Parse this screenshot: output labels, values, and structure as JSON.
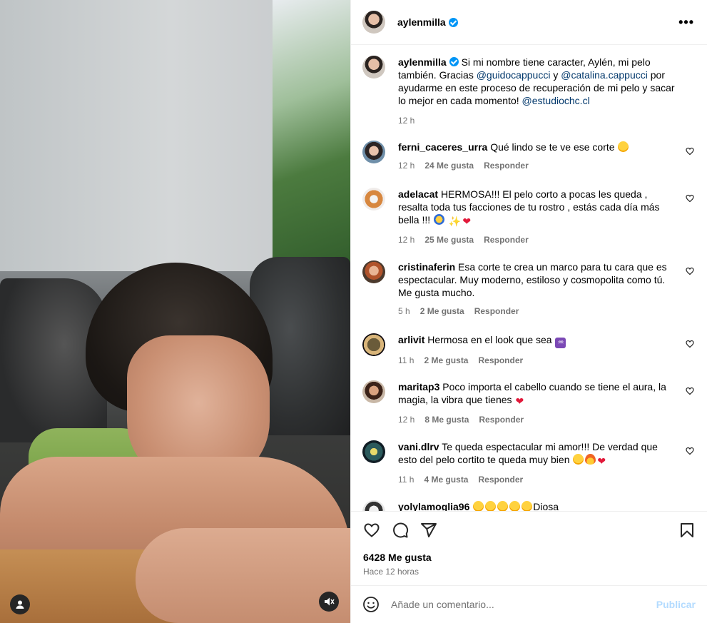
{
  "post": {
    "username": "aylenmilla",
    "caption_before": " Si mi nombre tiene caracter, Aylén, mi pelo también. Gracias ",
    "mention1": "@guidocappucci",
    "caption_mid": " y ",
    "mention2": "@catalina.cappucci",
    "caption_after": " por ayudarme en este proceso de recuperación de mi pelo y sacar lo mejor en cada momento! ",
    "mention3": "@estudiochc.cl",
    "caption_time": "12 h"
  },
  "comments": [
    {
      "username": "ferni_caceres_urra",
      "text": "Qué lindo se te ve ese corte",
      "emojis": [
        "star-eyes"
      ],
      "time": "12 h",
      "likes": "24 Me gusta",
      "reply": "Responder"
    },
    {
      "username": "adelacat",
      "text": "HERMOSA!!! El pelo corto a pocas les queda , resalta toda tus facciones de tu rostro , estás cada día más bella !!!",
      "emojis": [
        "sunglasses",
        "sparkles",
        "heart"
      ],
      "time": "12 h",
      "likes": "25 Me gusta",
      "reply": "Responder"
    },
    {
      "username": "cristinaferin",
      "text": "Esa corte te crea un marco para tu cara que es espectacular. Muy moderno, estiloso y cosmopolita como tú. Me gusta mucho.",
      "emojis": [],
      "time": "5 h",
      "likes": "2 Me gusta",
      "reply": "Responder"
    },
    {
      "username": "arlivit",
      "text": "Hermosa en el look que sea",
      "emojis": [
        "aquarius"
      ],
      "time": "11 h",
      "likes": "2 Me gusta",
      "reply": "Responder"
    },
    {
      "username": "maritap3",
      "text": "Poco importa el cabello cuando se tiene el aura, la magia, la vibra que tienes",
      "emojis": [
        "heart"
      ],
      "time": "12 h",
      "likes": "8 Me gusta",
      "reply": "Responder"
    },
    {
      "username": "vani.dlrv",
      "text": "Te queda espectacular mi amor!!! De verdad que esto del pelo cortito te queda muy bien",
      "emojis": [
        "star-eyes",
        "fire",
        "heart"
      ],
      "time": "11 h",
      "likes": "4 Me gusta",
      "reply": "Responder"
    },
    {
      "username": "yolylamoglia96",
      "text": "Diosa",
      "emojis": [
        "star-eyes",
        "star-eyes",
        "star-eyes",
        "star-eyes",
        "star-eyes"
      ],
      "time": "",
      "likes": "",
      "reply": ""
    }
  ],
  "actions": {
    "likes": "6428 Me gusta",
    "time": "Hace 12 horas"
  },
  "add_comment": {
    "placeholder": "Añade un comentario...",
    "publish": "Publicar"
  },
  "icons": [
    "user-tag-icon",
    "mute-icon",
    "more-icon",
    "heart-icon",
    "comment-icon",
    "share-icon",
    "save-icon",
    "emoji-icon",
    "verified-icon"
  ],
  "colors": {
    "link": "#00376b",
    "verified": "#0095f6",
    "publish_disabled": "#b3dbff",
    "secondary_text": "#737373"
  }
}
